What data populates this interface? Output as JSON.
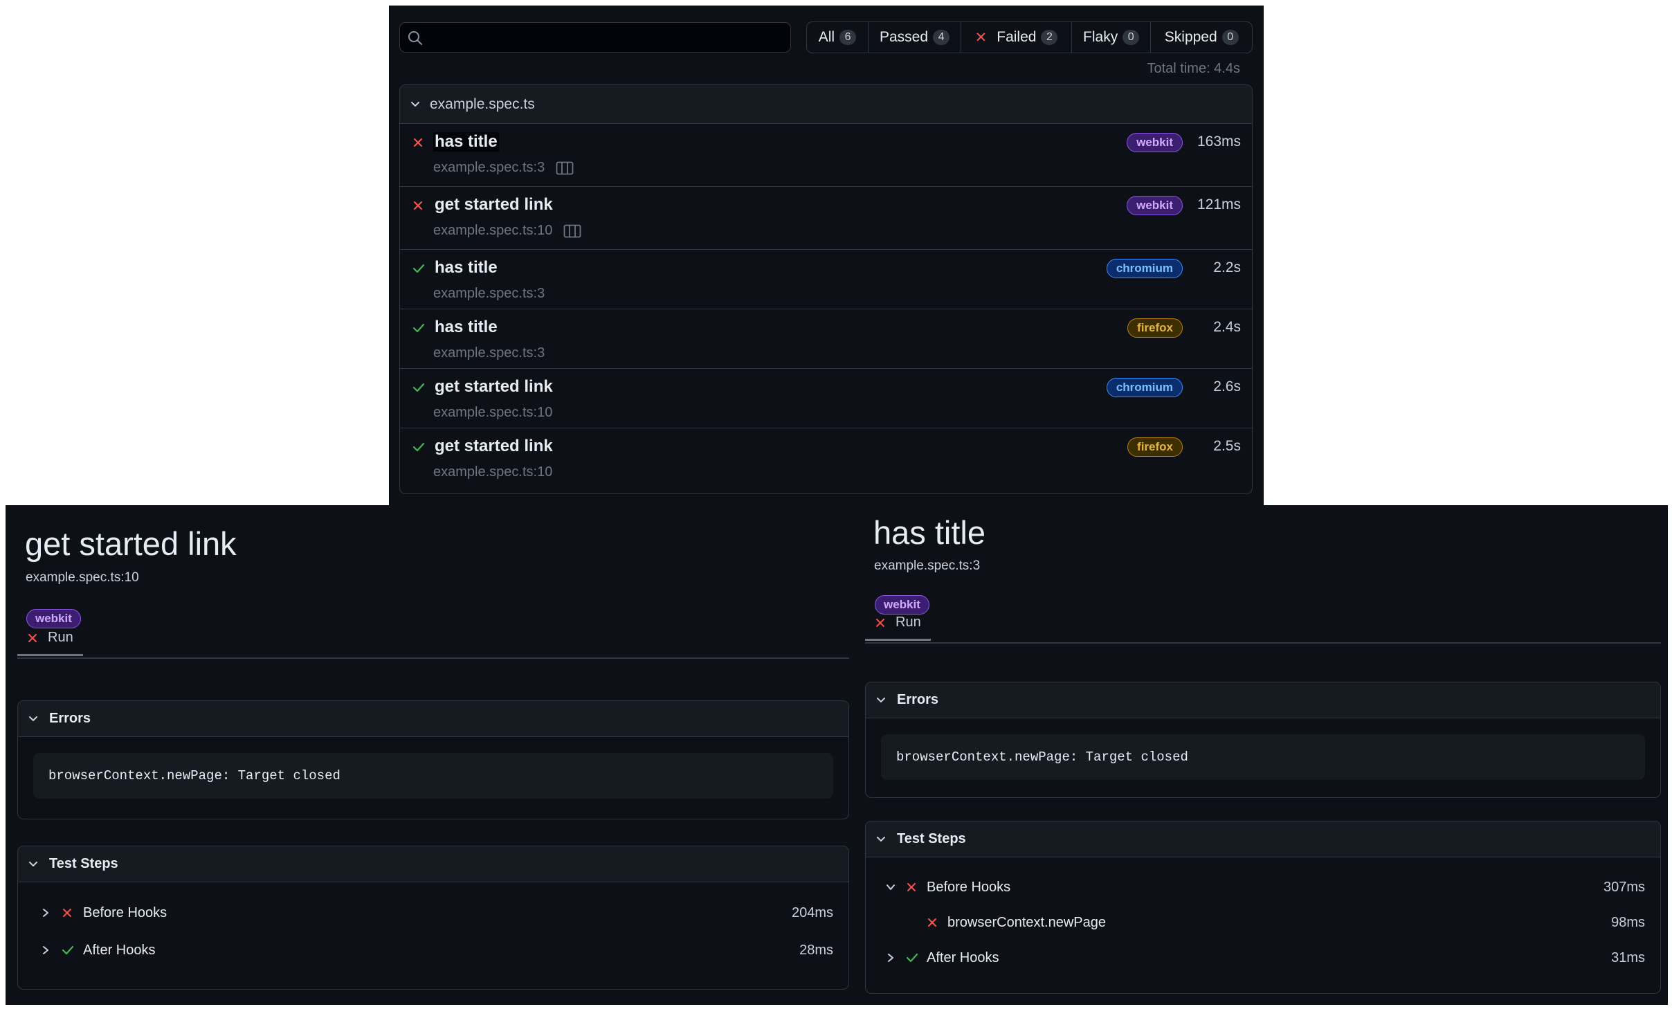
{
  "list": {
    "search": {
      "placeholder": "",
      "value": ""
    },
    "filters": [
      {
        "label": "All",
        "count": "6"
      },
      {
        "label": "Passed",
        "count": "4"
      },
      {
        "label": "Failed",
        "count": "2"
      },
      {
        "label": "Flaky",
        "count": "0"
      },
      {
        "label": "Skipped",
        "count": "0"
      }
    ],
    "total_time": "Total time: 4.4s",
    "file": "example.spec.ts",
    "tests": [
      {
        "status": "failed",
        "title": "has title",
        "location": "example.spec.ts:3",
        "tag": "webkit",
        "duration": "163ms",
        "trace": true
      },
      {
        "status": "failed",
        "title": "get started link",
        "location": "example.spec.ts:10",
        "tag": "webkit",
        "duration": "121ms",
        "trace": true
      },
      {
        "status": "passed",
        "title": "has title",
        "location": "example.spec.ts:3",
        "tag": "chromium",
        "duration": "2.2s",
        "trace": false
      },
      {
        "status": "passed",
        "title": "has title",
        "location": "example.spec.ts:3",
        "tag": "firefox",
        "duration": "2.4s",
        "trace": false
      },
      {
        "status": "passed",
        "title": "get started link",
        "location": "example.spec.ts:10",
        "tag": "chromium",
        "duration": "2.6s",
        "trace": false
      },
      {
        "status": "passed",
        "title": "get started link",
        "location": "example.spec.ts:10",
        "tag": "firefox",
        "duration": "2.5s",
        "trace": false
      }
    ]
  },
  "detail_left": {
    "title": "get started link",
    "location": "example.spec.ts:10",
    "tag": "webkit",
    "tab": "Run",
    "errors_header": "Errors",
    "error": "browserContext.newPage: Target closed",
    "steps_header": "Test Steps",
    "steps": [
      {
        "label": "Before Hooks",
        "status": "failed",
        "duration": "204ms"
      },
      {
        "label": "After Hooks",
        "status": "passed",
        "duration": "28ms"
      }
    ]
  },
  "detail_right": {
    "title": "has title",
    "location": "example.spec.ts:3",
    "tag": "webkit",
    "tab": "Run",
    "errors_header": "Errors",
    "error": "browserContext.newPage: Target closed",
    "steps_header": "Test Steps",
    "steps": [
      {
        "label": "Before Hooks",
        "status": "failed",
        "duration": "307ms"
      },
      {
        "label": "browserContext.newPage",
        "status": "failed",
        "duration": "98ms"
      },
      {
        "label": "After Hooks",
        "status": "passed",
        "duration": "31ms"
      }
    ]
  },
  "colors": {
    "background": "#0d1117",
    "failed": "#f85149",
    "passed": "#3fb950",
    "webkit": "#d2a8ff",
    "chromium": "#79c0ff",
    "firefox": "#e3b341"
  }
}
